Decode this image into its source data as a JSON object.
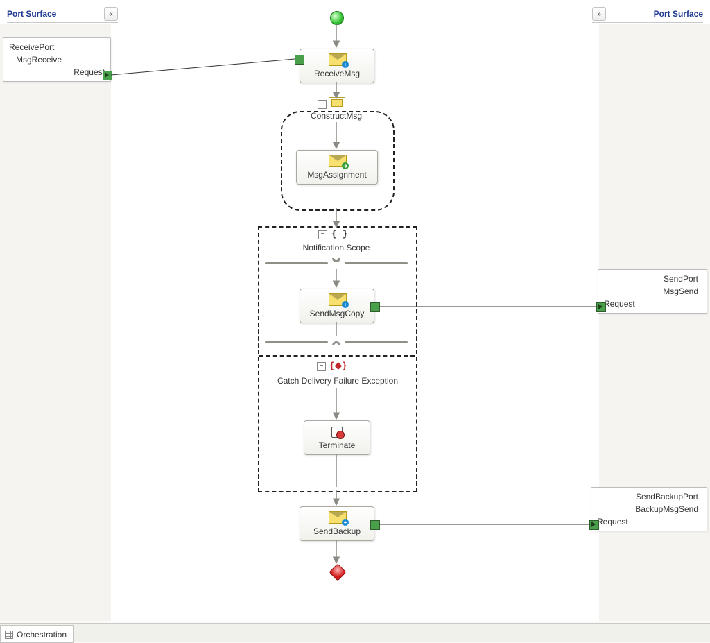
{
  "port_surface": {
    "left_title": "Port Surface",
    "right_title": "Port Surface"
  },
  "left_ports": [
    {
      "name": "ReceivePort",
      "operation": "MsgReceive",
      "part": "Request"
    }
  ],
  "right_ports": [
    {
      "name": "SendPort",
      "operation": "MsgSend",
      "part": "Request"
    },
    {
      "name": "SendBackupPort",
      "operation": "BackupMsgSend",
      "part": "Request"
    }
  ],
  "shapes": {
    "receive": "ReceiveMsg",
    "construct_scope": "ConstructMsg",
    "assignment": "MsgAssignment",
    "notif_scope": "Notification Scope",
    "send_copy": "SendMsgCopy",
    "catch_block": "Catch Delivery Failure Exception",
    "terminate": "Terminate",
    "send_backup": "SendBackup"
  },
  "tab": {
    "label": "Orchestration"
  }
}
